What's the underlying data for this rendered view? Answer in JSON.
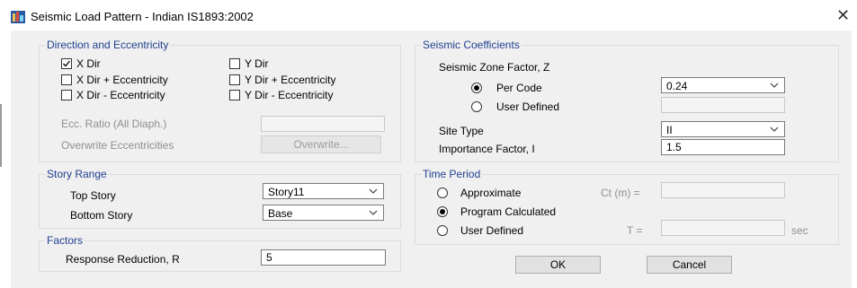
{
  "window": {
    "title": "Seismic Load Pattern - Indian IS1893:2002",
    "close_icon": "close-x-icon"
  },
  "direction": {
    "legend": "Direction and Eccentricity",
    "checkboxes": [
      {
        "label": "X Dir",
        "checked": true
      },
      {
        "label": "Y Dir",
        "checked": false
      },
      {
        "label": "X Dir + Eccentricity",
        "checked": false
      },
      {
        "label": "Y Dir + Eccentricity",
        "checked": false
      },
      {
        "label": "X Dir - Eccentricity",
        "checked": false
      },
      {
        "label": "Y Dir - Eccentricity",
        "checked": false
      }
    ],
    "ecc_ratio_label": "Ecc. Ratio (All Diaph.)",
    "ecc_ratio_value": "",
    "overwrite_label": "Overwrite Eccentricities",
    "overwrite_button": "Overwrite..."
  },
  "story_range": {
    "legend": "Story Range",
    "top_story_label": "Top Story",
    "top_story_value": "Story11",
    "bottom_story_label": "Bottom Story",
    "bottom_story_value": "Base"
  },
  "factors": {
    "legend": "Factors",
    "response_reduction_label": "Response Reduction, R",
    "response_reduction_value": "5"
  },
  "seismic": {
    "legend": "Seismic Coefficients",
    "zone_factor_label": "Seismic Zone Factor, Z",
    "per_code_label": "Per Code",
    "per_code_value": "0.24",
    "user_defined_label": "User Defined",
    "user_defined_value": "",
    "zone_selected": "per_code",
    "site_type_label": "Site Type",
    "site_type_value": "II",
    "importance_label": "Importance Factor, I",
    "importance_value": "1.5"
  },
  "time_period": {
    "legend": "Time Period",
    "approximate_label": "Approximate",
    "ct_label": "Ct (m) =",
    "ct_value": "",
    "program_label": "Program Calculated",
    "user_defined_label": "User Defined",
    "t_label": "T =",
    "t_value": "",
    "sec_label": "sec",
    "selected": "program_calculated"
  },
  "buttons": {
    "ok": "OK",
    "cancel": "Cancel"
  }
}
